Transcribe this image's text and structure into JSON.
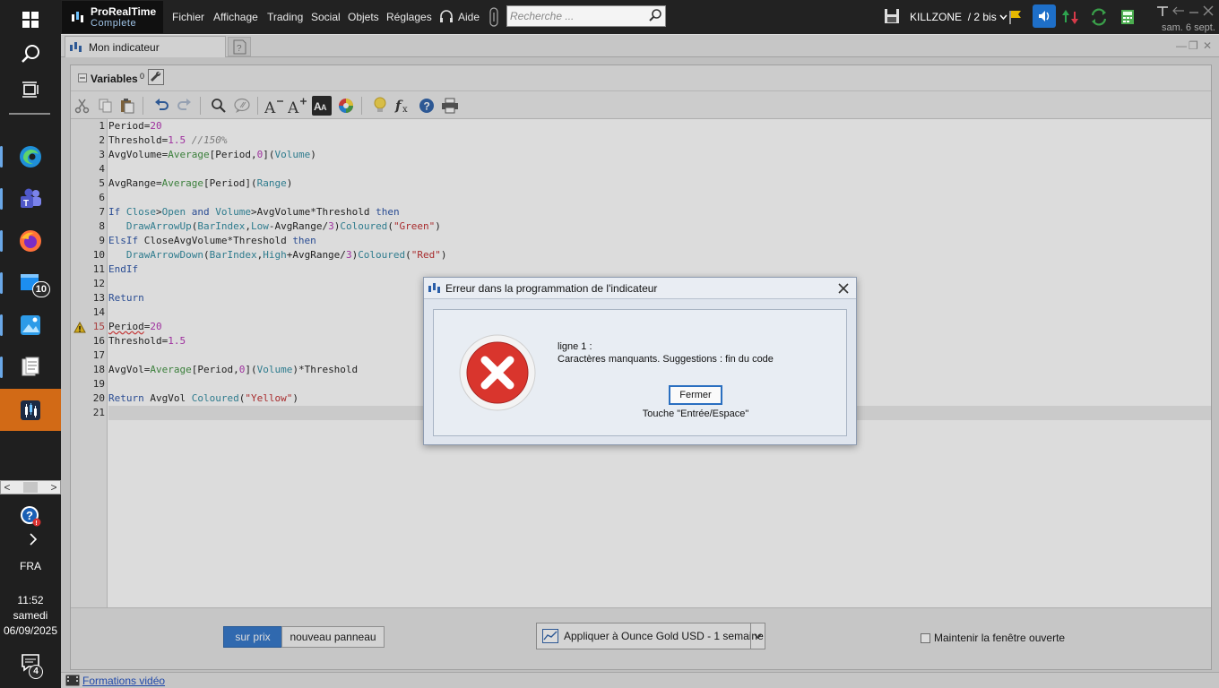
{
  "taskbar": {
    "lang": "FRA",
    "time": "11:52",
    "day": "samedi",
    "date": "06/09/2025",
    "badge_app5": "10",
    "badge_notifications": "4"
  },
  "app": {
    "logo_title": "ProRealTime",
    "logo_subtitle": "Complete",
    "menu": [
      "Fichier",
      "Affichage",
      "Trading",
      "Social",
      "Objets",
      "Réglages"
    ],
    "help_label": "Aide",
    "search_placeholder": "Recherche ...",
    "workspace": "KILLZONE",
    "workspace_suffix": "/ 2 bis",
    "date_text": "sam. 6 sept."
  },
  "tab": {
    "title": "Mon indicateur"
  },
  "editor": {
    "variables_label": "Variables",
    "variables_count": "0",
    "warning_line": 15,
    "lines_count": 21
  },
  "bottom": {
    "sur_prix": "sur prix",
    "nouveau_panneau": "nouveau panneau",
    "apply_to": "Appliquer à Ounce Gold USD - 1 semaine",
    "keep_open": "Maintenir la fenêtre ouverte"
  },
  "status": {
    "formations": "Formations vidéo"
  },
  "dialog": {
    "title": "Erreur dans la programmation de l'indicateur",
    "line": "ligne 1 :",
    "message": "Caractères manquants. Suggestions : fin du code",
    "button": "Fermer",
    "hint": "Touche \"Entrée/Espace\""
  }
}
